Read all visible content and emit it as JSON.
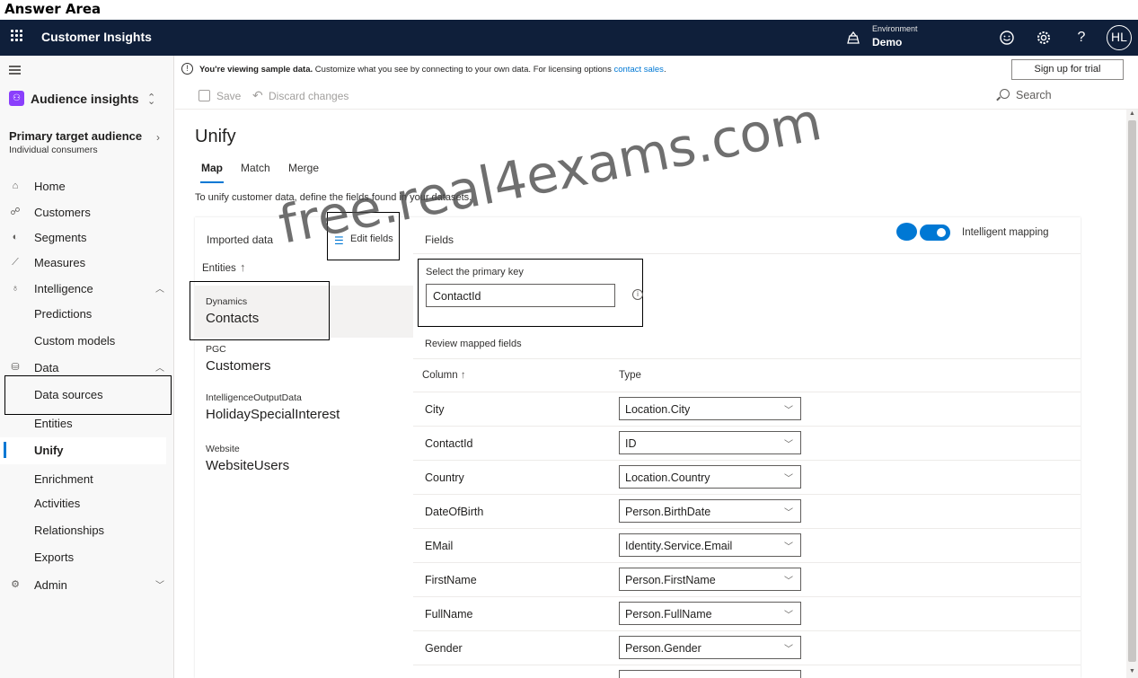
{
  "answer_area": "Answer Area",
  "topbar": {
    "app_title": "Customer Insights",
    "environment_label": "Environment",
    "environment_value": "Demo",
    "help": "?",
    "avatar_initials": "HL"
  },
  "sidebar": {
    "app_switch": "Audience insights",
    "audience_title": "Primary target audience",
    "audience_sub": "Individual consumers",
    "nav": [
      {
        "label": "Home"
      },
      {
        "label": "Customers"
      },
      {
        "label": "Segments"
      },
      {
        "label": "Measures"
      },
      {
        "label": "Intelligence"
      },
      {
        "label": "Predictions"
      },
      {
        "label": "Custom models"
      },
      {
        "label": "Data"
      },
      {
        "label": "Data sources"
      },
      {
        "label": "Entities"
      },
      {
        "label": "Unify"
      },
      {
        "label": "Enrichment"
      },
      {
        "label": "Activities"
      },
      {
        "label": "Relationships"
      },
      {
        "label": "Exports"
      },
      {
        "label": "Admin"
      }
    ]
  },
  "banner": {
    "bold": "You're viewing sample data.",
    "text": " Customize what you see by connecting to your own data. For licensing options ",
    "link": "contact sales",
    "end": ".",
    "trial_button": "Sign up for trial"
  },
  "command_bar": {
    "save": "Save",
    "discard": "Discard changes",
    "search": "Search"
  },
  "page": {
    "title": "Unify",
    "tabs": [
      "Map",
      "Match",
      "Merge"
    ],
    "active_tab": "Map",
    "description": "To unify customer data, define the fields found in your datasets."
  },
  "imported": {
    "title": "Imported data",
    "edit_fields": "Edit fields",
    "entities_label": "Entities",
    "entities": [
      {
        "source": "Dynamics",
        "name": "Contacts",
        "selected": true
      },
      {
        "source": "PGC",
        "name": "Customers"
      },
      {
        "source": "IntelligenceOutputData",
        "name": "HolidaySpecialInterest"
      },
      {
        "source": "Website",
        "name": "WebsiteUsers"
      }
    ]
  },
  "fields": {
    "title": "Fields",
    "intelligent_mapping": "Intelligent mapping",
    "intelligent_mapping_on": true,
    "primary_key_label": "Select the primary key",
    "primary_key_value": "ContactId",
    "review_label": "Review mapped fields",
    "column_header": "Column",
    "type_header": "Type",
    "rows": [
      {
        "column": "City",
        "type": "Location.City"
      },
      {
        "column": "ContactId",
        "type": "ID"
      },
      {
        "column": "Country",
        "type": "Location.Country"
      },
      {
        "column": "DateOfBirth",
        "type": "Person.BirthDate"
      },
      {
        "column": "EMail",
        "type": "Identity.Service.Email"
      },
      {
        "column": "FirstName",
        "type": "Person.FirstName"
      },
      {
        "column": "FullName",
        "type": "Person.FullName"
      },
      {
        "column": "Gender",
        "type": "Person.Gender"
      },
      {
        "column": "",
        "type": ""
      }
    ]
  },
  "watermark": "free.real4exams.com",
  "colors": {
    "topbar": "#0f1f3a",
    "accent": "#0078d4"
  }
}
